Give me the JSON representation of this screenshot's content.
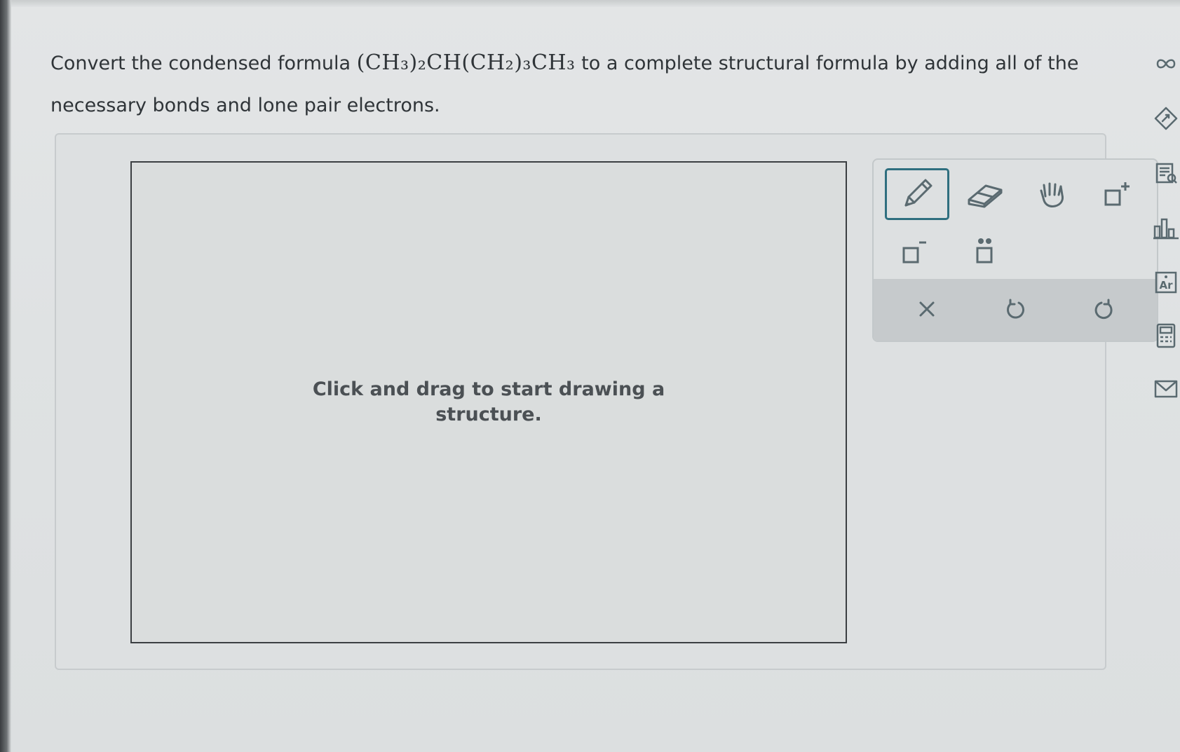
{
  "question": {
    "prefix": "Convert the condensed formula ",
    "formula": "(CH₃)₂CH(CH₂)₃CH₃",
    "suffix": " to a complete structural formula by adding all of the necessary bonds and lone pair electrons."
  },
  "canvas": {
    "hint": "Click and drag to start drawing a structure."
  },
  "toolbar": {
    "tools": [
      {
        "name": "pencil-tool",
        "icon": "pencil-icon",
        "active": true
      },
      {
        "name": "eraser-tool",
        "icon": "eraser-icon",
        "active": false
      },
      {
        "name": "hand-tool",
        "icon": "hand-icon",
        "active": false
      },
      {
        "name": "positive-charge-tool",
        "icon": "positive-charge-icon",
        "active": false
      },
      {
        "name": "negative-charge-tool",
        "icon": "negative-charge-icon",
        "active": false
      },
      {
        "name": "lone-pair-tool",
        "icon": "lone-pair-icon",
        "active": false
      }
    ],
    "actions": [
      {
        "name": "clear-button",
        "icon": "close-icon"
      },
      {
        "name": "undo-button",
        "icon": "undo-icon"
      },
      {
        "name": "redo-button",
        "icon": "redo-icon"
      }
    ]
  },
  "side_rail": {
    "icons": [
      "infinity-icon",
      "edit-diamond-icon",
      "notes-search-icon",
      "chart-icon",
      "periodic-table-icon",
      "calculator-icon",
      "mail-icon"
    ]
  },
  "colors": {
    "accent": "#2f6f7f",
    "icon": "#5a6a70"
  }
}
